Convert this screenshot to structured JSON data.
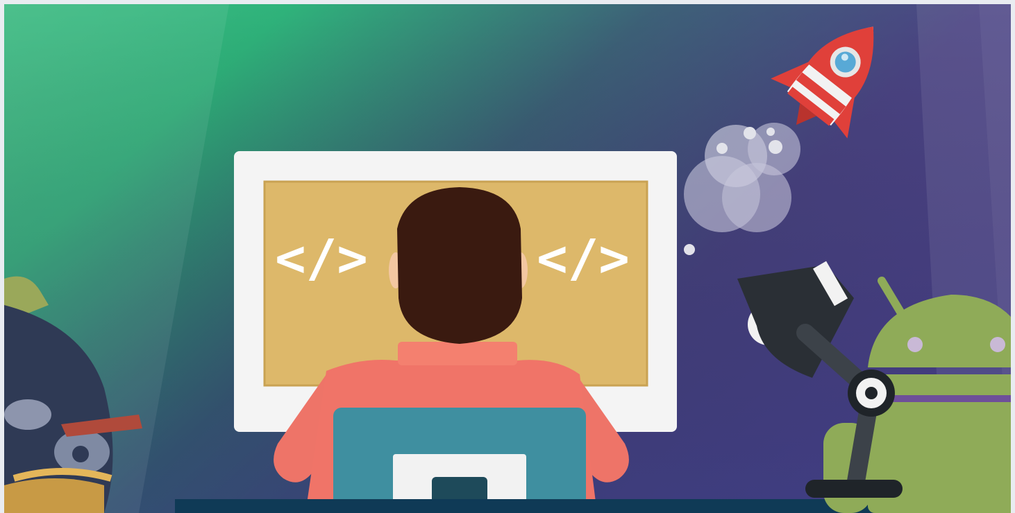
{
  "illustration": {
    "screen_left_code": "</>",
    "screen_right_code": "</>",
    "icons": [
      "code-icon",
      "rocket-icon",
      "desk-lamp-icon",
      "android-robot-icon",
      "angry-bird-icon"
    ],
    "colors": {
      "bg_top_left": "#3fb57f",
      "bg_purple": "#4e3f86",
      "monitor_frame": "#f5f5f5",
      "monitor_screen": "#dfb86a",
      "hair": "#3a1a10",
      "shirt": "#f07468",
      "chair": "#3f8fa0",
      "desk": "#0f3a56",
      "rocket_red": "#e0403a",
      "android_green": "#8fab58",
      "lamp_dark": "#2a2f35"
    }
  }
}
